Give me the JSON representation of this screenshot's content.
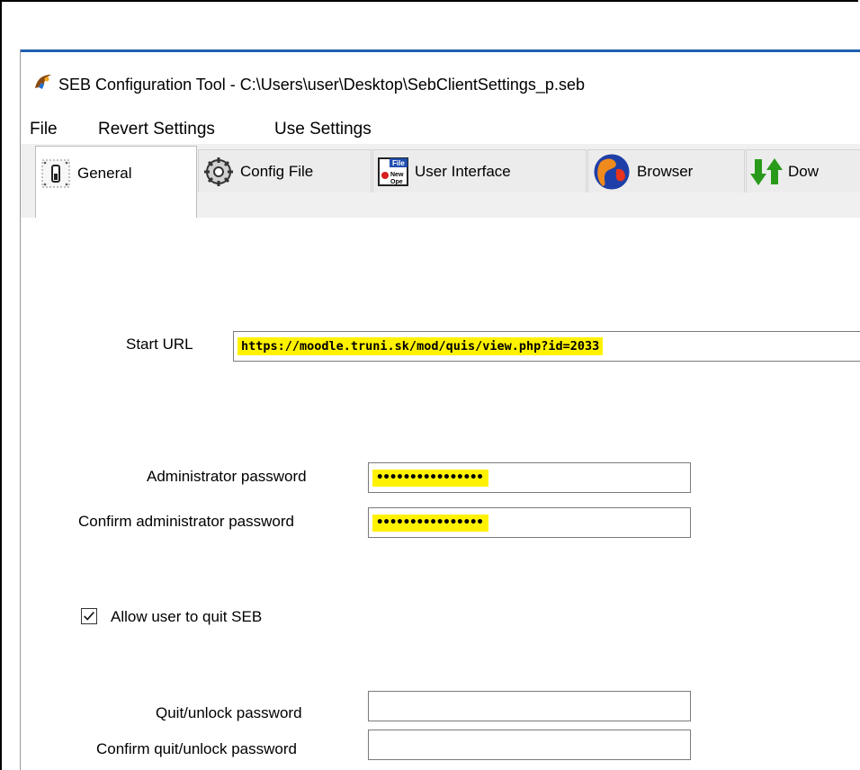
{
  "window": {
    "title": "SEB Configuration Tool - C:\\Users\\user\\Desktop\\SebClientSettings_p.seb",
    "app_icon": "seb-app-icon"
  },
  "menu": {
    "items": [
      "File",
      "Revert Settings",
      "Use Settings"
    ]
  },
  "tabs": [
    {
      "label": "General",
      "icon": "switch-icon",
      "active": true
    },
    {
      "label": "Config File",
      "icon": "gear-icon",
      "active": false
    },
    {
      "label": "User Interface",
      "icon": "window-icon",
      "active": false
    },
    {
      "label": "Browser",
      "icon": "browser-globe-icon",
      "active": false
    },
    {
      "label": "Dow",
      "icon": "up-down-arrows-icon",
      "active": false
    }
  ],
  "general": {
    "start_url_label": "Start URL",
    "start_url_value": "https://moodle.truni.sk/mod/quis/view.php?id=2033",
    "admin_password_label": "Administrator password",
    "admin_password_value": "••••••••••••••••",
    "confirm_admin_password_label": "Confirm administrator password",
    "confirm_admin_password_value": "••••••••••••••••",
    "allow_quit_label": "Allow user to quit SEB",
    "allow_quit_checked": true,
    "quit_password_label": "Quit/unlock password",
    "quit_password_value": "",
    "confirm_quit_password_label": "Confirm quit/unlock password",
    "confirm_quit_password_value": ""
  },
  "colors": {
    "highlight": "#fff200",
    "title_accent": "#1f5fb0"
  }
}
